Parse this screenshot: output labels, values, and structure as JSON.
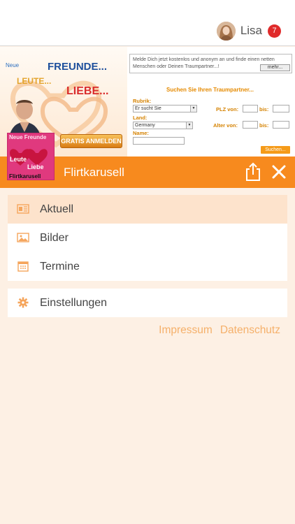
{
  "header": {
    "user_name": "Lisa",
    "notification_count": "7"
  },
  "banner": {
    "words": {
      "neue": "Neue",
      "freunde": "FREUNDE...",
      "leute": "LEUTE...",
      "liebe": "LIEBE..."
    },
    "gratis_label": "GRATIS ANMELDEN",
    "intro_text": "Melde Dich jetzt kostenlos und anonym an und finde einen netten Menschen oder Deinen Traumpartner...!",
    "mehr_label": "mehr...",
    "search_title": "Suchen Sie Ihren Traumpartner...",
    "rubrik_label": "Rubrik:",
    "rubrik_value": "Er sucht Sie",
    "land_label": "Land:",
    "land_value": "Germany",
    "name_label": "Name:",
    "plz_label": "PLZ von:",
    "bis_label": "bis:",
    "alter_label": "Alter von:",
    "bis2_label": "bis:",
    "suchen_label": "Suchen...",
    "thumb_lines": [
      "Neue Freunde",
      "Leute",
      "Liebe",
      "Flirtkarusell"
    ]
  },
  "titlebar": {
    "title": "Flirtkarusell"
  },
  "menu": {
    "items": [
      {
        "label": "Aktuell",
        "icon": "news-icon",
        "active": true
      },
      {
        "label": "Bilder",
        "icon": "image-icon",
        "active": false
      },
      {
        "label": "Termine",
        "icon": "calendar-icon",
        "active": false
      }
    ],
    "settings": {
      "label": "Einstellungen",
      "icon": "gear-icon"
    }
  },
  "footer": {
    "impressum": "Impressum",
    "datenschutz": "Datenschutz"
  },
  "colors": {
    "accent": "#f78a1e",
    "active_row": "#fde3cc",
    "background": "#fdf0e4",
    "link": "#f5b06a",
    "badge": "#e02b2b"
  }
}
